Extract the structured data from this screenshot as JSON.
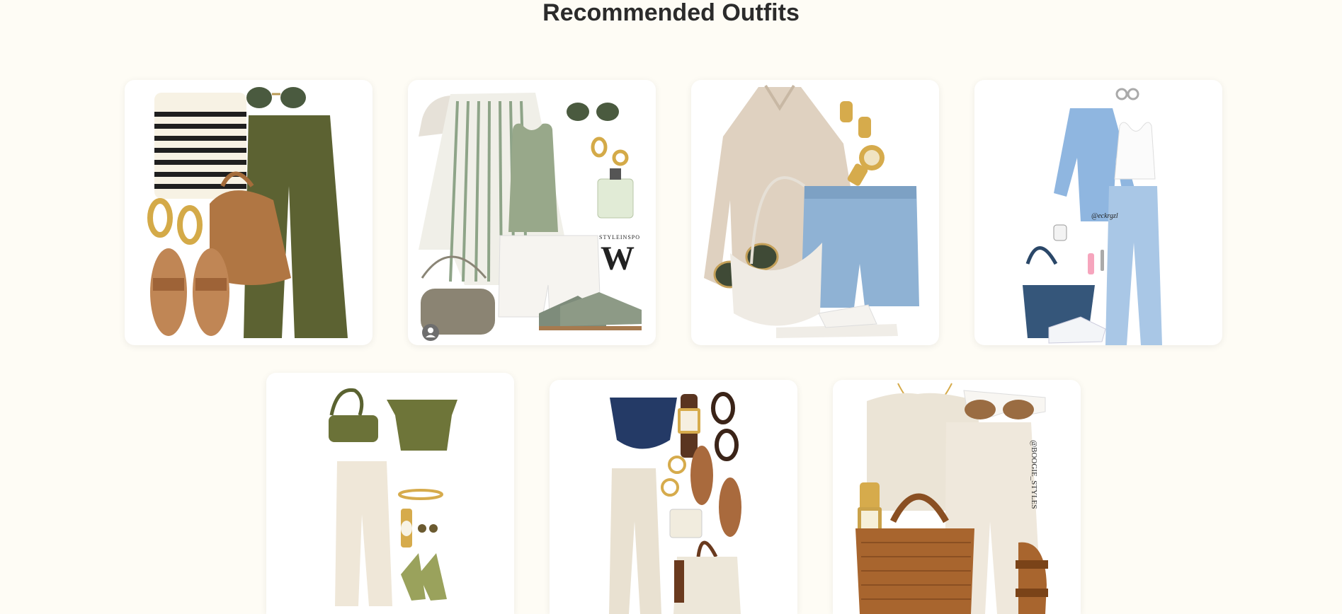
{
  "page": {
    "title": "Recommended Outfits"
  },
  "outfits": [
    {
      "watermark": ""
    },
    {
      "watermark": "STYLEINSPO"
    },
    {
      "watermark": ""
    },
    {
      "watermark": "@eckrgzl"
    },
    {
      "watermark": ""
    },
    {
      "watermark": ""
    },
    {
      "watermark": "@BOOGIE_STYLES"
    }
  ],
  "colors": {
    "background": "#fefcf5",
    "card": "#ffffff",
    "title": "#2b2b2b"
  }
}
